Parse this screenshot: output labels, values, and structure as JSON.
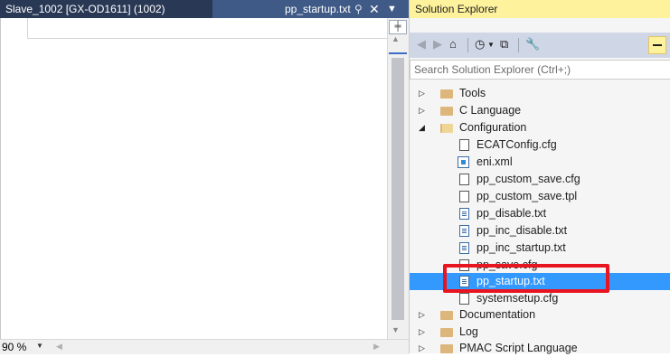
{
  "editor": {
    "tab_inactive": "Slave_1002 [GX-OD1611] (1002)",
    "tab_active": "pp_startup.txt",
    "pin_glyph": "⚲",
    "close_glyph": "✕",
    "dropdown_glyph": "▼",
    "zoom": "90 %"
  },
  "solution_explorer": {
    "title": "Solution Explorer",
    "search_placeholder": "Search Solution Explorer (Ctrl+;)",
    "tree": [
      {
        "label": "Tools",
        "type": "folder",
        "expanded": false
      },
      {
        "label": "C Language",
        "type": "folder",
        "expanded": false
      },
      {
        "label": "Configuration",
        "type": "folder",
        "expanded": true
      },
      {
        "label": "ECATConfig.cfg",
        "type": "file"
      },
      {
        "label": "eni.xml",
        "type": "xml"
      },
      {
        "label": "pp_custom_save.cfg",
        "type": "file"
      },
      {
        "label": "pp_custom_save.tpl",
        "type": "file"
      },
      {
        "label": "pp_disable.txt",
        "type": "text"
      },
      {
        "label": "pp_inc_disable.txt",
        "type": "text"
      },
      {
        "label": "pp_inc_startup.txt",
        "type": "text"
      },
      {
        "label": "pp_save.cfg",
        "type": "file"
      },
      {
        "label": "pp_startup.txt",
        "type": "text",
        "selected": true
      },
      {
        "label": "systemsetup.cfg",
        "type": "file"
      },
      {
        "label": "Documentation",
        "type": "folder",
        "expanded": false
      },
      {
        "label": "Log",
        "type": "folder",
        "expanded": false
      },
      {
        "label": "PMAC Script Language",
        "type": "folder",
        "expanded": false
      }
    ]
  },
  "colors": {
    "tab_bar": "#293955",
    "selection": "#3399ff",
    "explorer_title": "#fff29d",
    "highlight_box": "#e8141f"
  }
}
